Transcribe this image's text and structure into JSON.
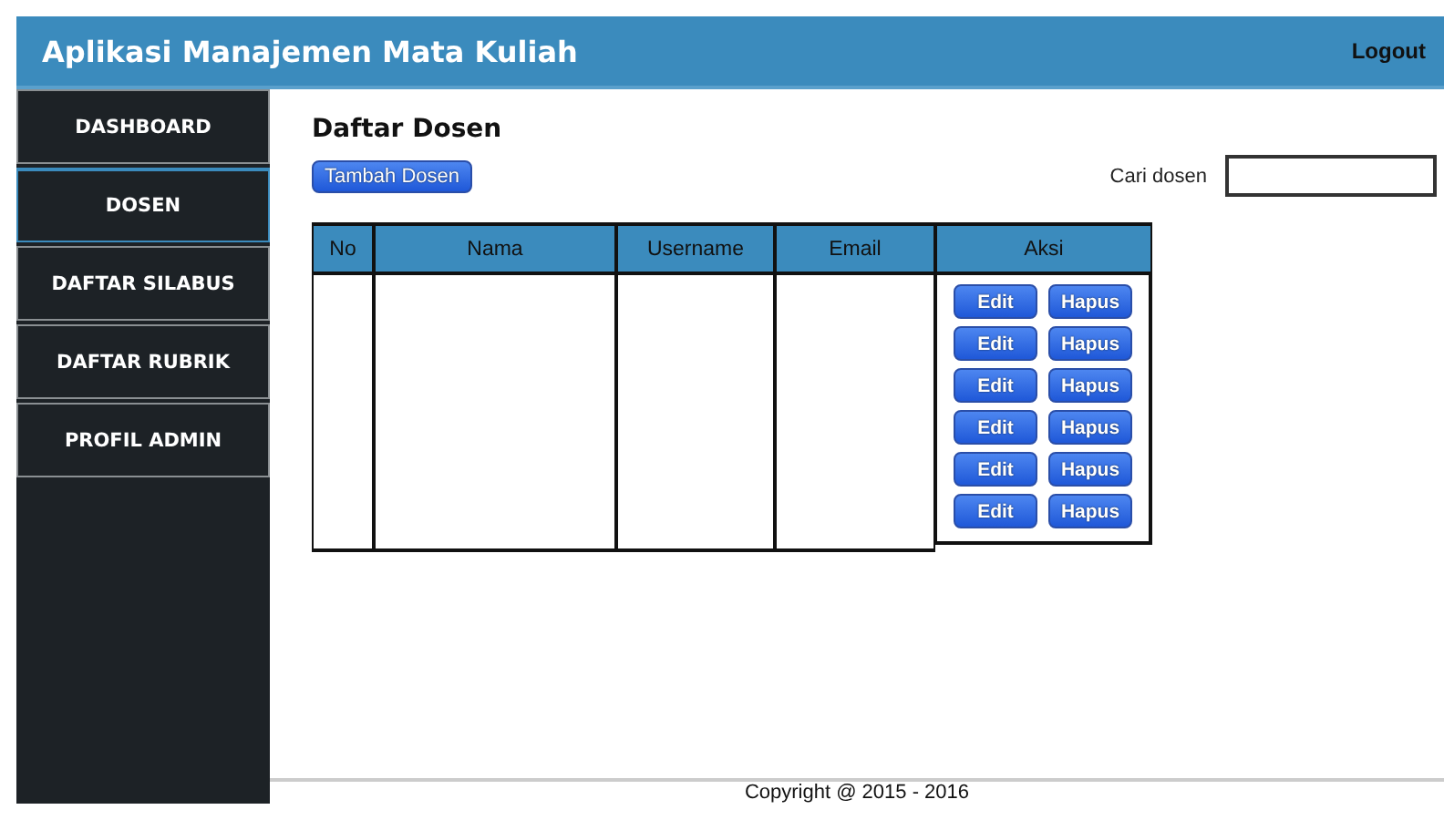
{
  "header": {
    "title": "Aplikasi Manajemen Mata Kuliah",
    "logout": "Logout"
  },
  "sidebar": {
    "items": [
      {
        "label": "DASHBOARD",
        "selected": false
      },
      {
        "label": "DOSEN",
        "selected": true
      },
      {
        "label": "DAFTAR SILABUS",
        "selected": false
      },
      {
        "label": "DAFTAR RUBRIK",
        "selected": false
      },
      {
        "label": "PROFIL ADMIN",
        "selected": false
      }
    ]
  },
  "page": {
    "title": "Daftar Dosen",
    "add_button": "Tambah Dosen",
    "search": {
      "label": "Cari dosen"
    }
  },
  "table": {
    "columns": [
      "No",
      "Nama",
      "Username",
      "Email",
      "Aksi"
    ],
    "actions": [
      {
        "edit": "Edit",
        "delete": "Hapus"
      },
      {
        "edit": "Edit",
        "delete": "Hapus"
      },
      {
        "edit": "Edit",
        "delete": "Hapus"
      },
      {
        "edit": "Edit",
        "delete": "Hapus"
      },
      {
        "edit": "Edit",
        "delete": "Hapus"
      },
      {
        "edit": "Edit",
        "delete": "Hapus"
      }
    ]
  },
  "footer": {
    "text": "Copyright @ 2015 - 2016"
  }
}
